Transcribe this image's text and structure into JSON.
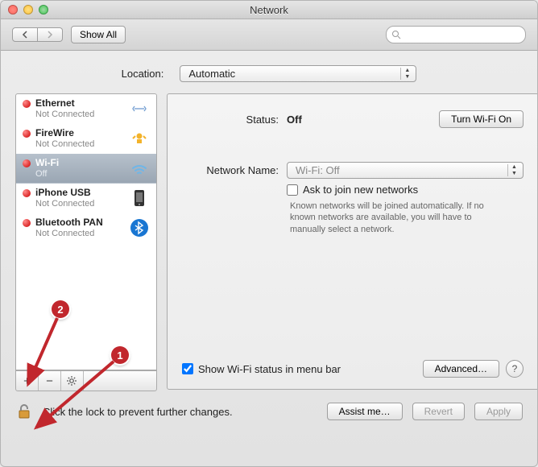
{
  "title": "Network",
  "toolbar": {
    "showall": "Show All"
  },
  "location": {
    "label": "Location:",
    "value": "Automatic"
  },
  "sidebar": {
    "items": [
      {
        "name": "Ethernet",
        "sub": "Not Connected"
      },
      {
        "name": "FireWire",
        "sub": "Not Connected"
      },
      {
        "name": "Wi-Fi",
        "sub": "Off"
      },
      {
        "name": "iPhone USB",
        "sub": "Not Connected"
      },
      {
        "name": "Bluetooth PAN",
        "sub": "Not Connected"
      }
    ]
  },
  "status": {
    "label": "Status:",
    "value": "Off",
    "button": "Turn Wi-Fi On"
  },
  "netname": {
    "label": "Network Name:",
    "value": "Wi-Fi: Off"
  },
  "ask": {
    "label": "Ask to join new networks",
    "help": "Known networks will be joined automatically. If no known networks are available, you will have to manually select a network."
  },
  "showstatus": "Show Wi-Fi status in menu bar",
  "advanced": "Advanced…",
  "lock_text": "Click the lock to prevent further changes.",
  "assist": "Assist me…",
  "revert": "Revert",
  "apply": "Apply",
  "callouts": {
    "one": "1",
    "two": "2"
  }
}
